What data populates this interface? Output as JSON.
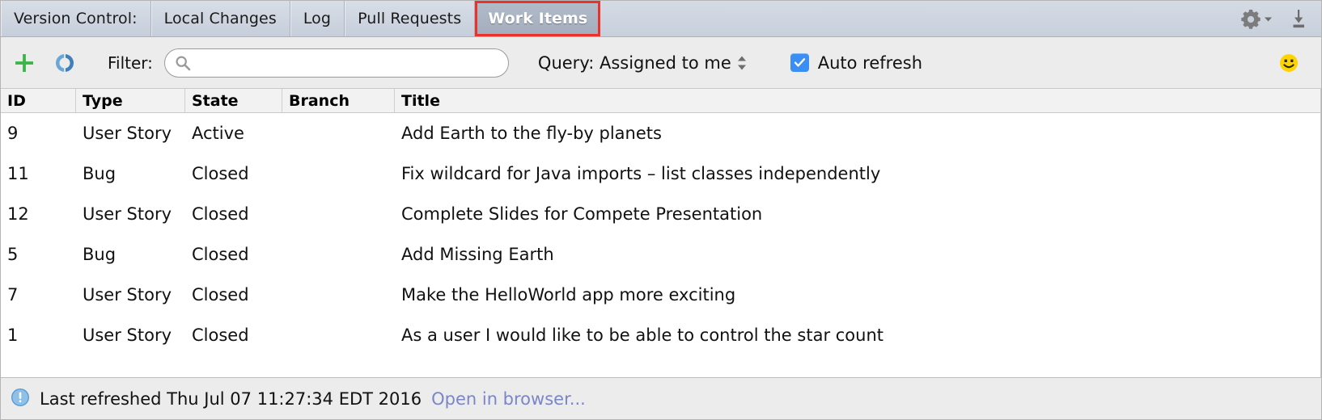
{
  "tabbar": {
    "title": "Version Control:",
    "tabs": [
      {
        "label": "Local Changes",
        "selected": false
      },
      {
        "label": "Log",
        "selected": false
      },
      {
        "label": "Pull Requests",
        "selected": false
      },
      {
        "label": "Work Items",
        "selected": true
      }
    ],
    "actions": [
      {
        "name": "settings-gear",
        "label": ""
      },
      {
        "name": "hide-panel",
        "label": ""
      }
    ],
    "selected_tab_highlight_color": "#e8322a",
    "background_color": "#ccd4e0"
  },
  "toolbar": {
    "add_label": "+",
    "refresh_label": "",
    "filter_label": "Filter:",
    "search_value": "",
    "search_placeholder": "",
    "query_label": "Query: Assigned to me",
    "auto_refresh_label": "Auto refresh",
    "auto_refresh_checked": true,
    "checkbox_color": "#3b8ef3",
    "add_color": "#3cb44a",
    "refresh_color": "#4a90d9",
    "smiley_color": "#ffd400"
  },
  "table": {
    "columns": [
      "ID",
      "Type",
      "State",
      "Branch",
      "Title"
    ],
    "rows": [
      {
        "id": "9",
        "type": "User Story",
        "state": "Active",
        "branch": "",
        "title": "Add Earth to the fly-by planets"
      },
      {
        "id": "11",
        "type": "Bug",
        "state": "Closed",
        "branch": "",
        "title": "Fix wildcard for Java imports – list classes independently"
      },
      {
        "id": "12",
        "type": "User Story",
        "state": "Closed",
        "branch": "",
        "title": "Complete Slides for Compete Presentation"
      },
      {
        "id": "5",
        "type": "Bug",
        "state": "Closed",
        "branch": "",
        "title": "Add Missing Earth"
      },
      {
        "id": "7",
        "type": "User Story",
        "state": "Closed",
        "branch": "",
        "title": "Make the HelloWorld app more exciting"
      },
      {
        "id": "1",
        "type": "User Story",
        "state": "Closed",
        "branch": "",
        "title": "As a user I would like to be able to control the star count"
      }
    ]
  },
  "statusbar": {
    "message": "Last refreshed Thu Jul 07 11:27:34 EDT 2016",
    "link": "Open in browser...",
    "link_color": "#7a86c8",
    "info_icon_color": "#5b9bd5"
  }
}
